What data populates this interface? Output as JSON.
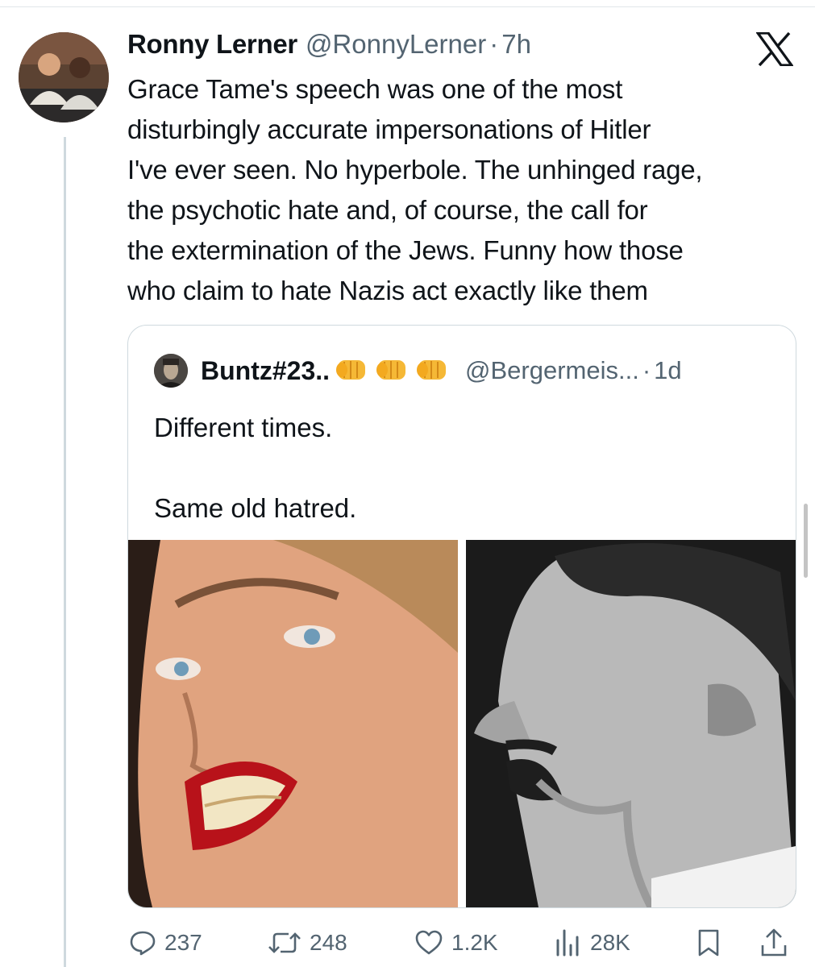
{
  "tweet": {
    "display_name": "Ronny Lerner",
    "handle": "@RonnyLerner",
    "separator": "·",
    "time": "7h",
    "lines": [
      "Grace Tame's speech was one of the most",
      "disturbingly accurate impersonations of Hitler",
      "I've ever seen. No hyperbole. The unhinged rage,",
      "the psychotic hate and, of course, the call for",
      "the extermination of the Jews. Funny how those",
      "who claim to hate Nazis act exactly like them"
    ]
  },
  "quote": {
    "display_name": "Buntz#23..",
    "emoji": [
      "oncoming-fist",
      "oncoming-fist",
      "oncoming-fist"
    ],
    "handle": "@Bergermeis...",
    "separator": "·",
    "time": "1d",
    "lines": [
      "Different times.",
      "Same old hatred."
    ]
  },
  "actions": {
    "replies": "237",
    "reposts": "248",
    "likes": "1.2K",
    "views": "28K"
  },
  "icons": {
    "reply": "speech-bubble-icon",
    "repost": "repost-arrows-icon",
    "like": "heart-icon",
    "views": "bar-chart-icon",
    "bookmark": "bookmark-icon",
    "share": "share-upload-icon",
    "platform": "x-logo-icon"
  },
  "colors": {
    "text": "#0f1419",
    "secondary": "#536471",
    "border": "#cfd9de"
  }
}
